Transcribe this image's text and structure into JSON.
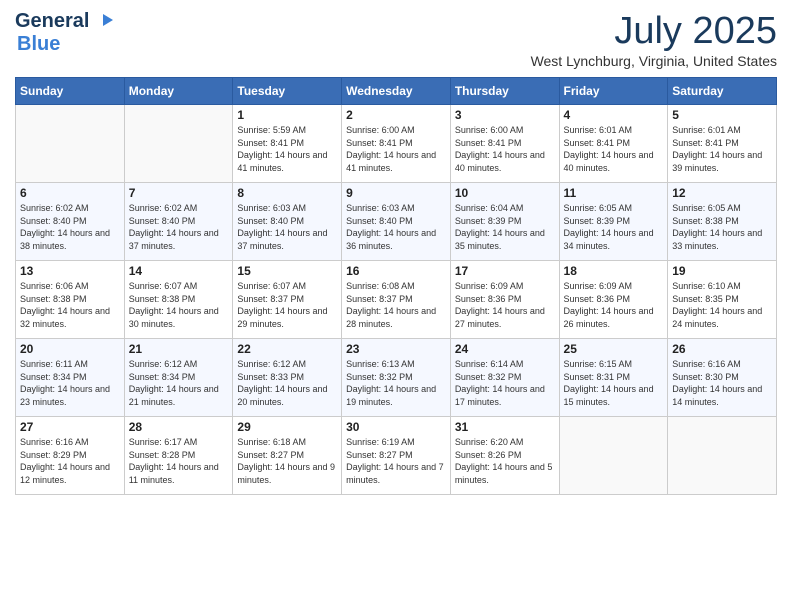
{
  "logo": {
    "part1": "General",
    "part2": "Blue"
  },
  "header": {
    "month": "July 2025",
    "location": "West Lynchburg, Virginia, United States"
  },
  "weekdays": [
    "Sunday",
    "Monday",
    "Tuesday",
    "Wednesday",
    "Thursday",
    "Friday",
    "Saturday"
  ],
  "weeks": [
    [
      {
        "day": "",
        "sunrise": "",
        "sunset": "",
        "daylight": ""
      },
      {
        "day": "",
        "sunrise": "",
        "sunset": "",
        "daylight": ""
      },
      {
        "day": "1",
        "sunrise": "Sunrise: 5:59 AM",
        "sunset": "Sunset: 8:41 PM",
        "daylight": "Daylight: 14 hours and 41 minutes."
      },
      {
        "day": "2",
        "sunrise": "Sunrise: 6:00 AM",
        "sunset": "Sunset: 8:41 PM",
        "daylight": "Daylight: 14 hours and 41 minutes."
      },
      {
        "day": "3",
        "sunrise": "Sunrise: 6:00 AM",
        "sunset": "Sunset: 8:41 PM",
        "daylight": "Daylight: 14 hours and 40 minutes."
      },
      {
        "day": "4",
        "sunrise": "Sunrise: 6:01 AM",
        "sunset": "Sunset: 8:41 PM",
        "daylight": "Daylight: 14 hours and 40 minutes."
      },
      {
        "day": "5",
        "sunrise": "Sunrise: 6:01 AM",
        "sunset": "Sunset: 8:41 PM",
        "daylight": "Daylight: 14 hours and 39 minutes."
      }
    ],
    [
      {
        "day": "6",
        "sunrise": "Sunrise: 6:02 AM",
        "sunset": "Sunset: 8:40 PM",
        "daylight": "Daylight: 14 hours and 38 minutes."
      },
      {
        "day": "7",
        "sunrise": "Sunrise: 6:02 AM",
        "sunset": "Sunset: 8:40 PM",
        "daylight": "Daylight: 14 hours and 37 minutes."
      },
      {
        "day": "8",
        "sunrise": "Sunrise: 6:03 AM",
        "sunset": "Sunset: 8:40 PM",
        "daylight": "Daylight: 14 hours and 37 minutes."
      },
      {
        "day": "9",
        "sunrise": "Sunrise: 6:03 AM",
        "sunset": "Sunset: 8:40 PM",
        "daylight": "Daylight: 14 hours and 36 minutes."
      },
      {
        "day": "10",
        "sunrise": "Sunrise: 6:04 AM",
        "sunset": "Sunset: 8:39 PM",
        "daylight": "Daylight: 14 hours and 35 minutes."
      },
      {
        "day": "11",
        "sunrise": "Sunrise: 6:05 AM",
        "sunset": "Sunset: 8:39 PM",
        "daylight": "Daylight: 14 hours and 34 minutes."
      },
      {
        "day": "12",
        "sunrise": "Sunrise: 6:05 AM",
        "sunset": "Sunset: 8:38 PM",
        "daylight": "Daylight: 14 hours and 33 minutes."
      }
    ],
    [
      {
        "day": "13",
        "sunrise": "Sunrise: 6:06 AM",
        "sunset": "Sunset: 8:38 PM",
        "daylight": "Daylight: 14 hours and 32 minutes."
      },
      {
        "day": "14",
        "sunrise": "Sunrise: 6:07 AM",
        "sunset": "Sunset: 8:38 PM",
        "daylight": "Daylight: 14 hours and 30 minutes."
      },
      {
        "day": "15",
        "sunrise": "Sunrise: 6:07 AM",
        "sunset": "Sunset: 8:37 PM",
        "daylight": "Daylight: 14 hours and 29 minutes."
      },
      {
        "day": "16",
        "sunrise": "Sunrise: 6:08 AM",
        "sunset": "Sunset: 8:37 PM",
        "daylight": "Daylight: 14 hours and 28 minutes."
      },
      {
        "day": "17",
        "sunrise": "Sunrise: 6:09 AM",
        "sunset": "Sunset: 8:36 PM",
        "daylight": "Daylight: 14 hours and 27 minutes."
      },
      {
        "day": "18",
        "sunrise": "Sunrise: 6:09 AM",
        "sunset": "Sunset: 8:36 PM",
        "daylight": "Daylight: 14 hours and 26 minutes."
      },
      {
        "day": "19",
        "sunrise": "Sunrise: 6:10 AM",
        "sunset": "Sunset: 8:35 PM",
        "daylight": "Daylight: 14 hours and 24 minutes."
      }
    ],
    [
      {
        "day": "20",
        "sunrise": "Sunrise: 6:11 AM",
        "sunset": "Sunset: 8:34 PM",
        "daylight": "Daylight: 14 hours and 23 minutes."
      },
      {
        "day": "21",
        "sunrise": "Sunrise: 6:12 AM",
        "sunset": "Sunset: 8:34 PM",
        "daylight": "Daylight: 14 hours and 21 minutes."
      },
      {
        "day": "22",
        "sunrise": "Sunrise: 6:12 AM",
        "sunset": "Sunset: 8:33 PM",
        "daylight": "Daylight: 14 hours and 20 minutes."
      },
      {
        "day": "23",
        "sunrise": "Sunrise: 6:13 AM",
        "sunset": "Sunset: 8:32 PM",
        "daylight": "Daylight: 14 hours and 19 minutes."
      },
      {
        "day": "24",
        "sunrise": "Sunrise: 6:14 AM",
        "sunset": "Sunset: 8:32 PM",
        "daylight": "Daylight: 14 hours and 17 minutes."
      },
      {
        "day": "25",
        "sunrise": "Sunrise: 6:15 AM",
        "sunset": "Sunset: 8:31 PM",
        "daylight": "Daylight: 14 hours and 15 minutes."
      },
      {
        "day": "26",
        "sunrise": "Sunrise: 6:16 AM",
        "sunset": "Sunset: 8:30 PM",
        "daylight": "Daylight: 14 hours and 14 minutes."
      }
    ],
    [
      {
        "day": "27",
        "sunrise": "Sunrise: 6:16 AM",
        "sunset": "Sunset: 8:29 PM",
        "daylight": "Daylight: 14 hours and 12 minutes."
      },
      {
        "day": "28",
        "sunrise": "Sunrise: 6:17 AM",
        "sunset": "Sunset: 8:28 PM",
        "daylight": "Daylight: 14 hours and 11 minutes."
      },
      {
        "day": "29",
        "sunrise": "Sunrise: 6:18 AM",
        "sunset": "Sunset: 8:27 PM",
        "daylight": "Daylight: 14 hours and 9 minutes."
      },
      {
        "day": "30",
        "sunrise": "Sunrise: 6:19 AM",
        "sunset": "Sunset: 8:27 PM",
        "daylight": "Daylight: 14 hours and 7 minutes."
      },
      {
        "day": "31",
        "sunrise": "Sunrise: 6:20 AM",
        "sunset": "Sunset: 8:26 PM",
        "daylight": "Daylight: 14 hours and 5 minutes."
      },
      {
        "day": "",
        "sunrise": "",
        "sunset": "",
        "daylight": ""
      },
      {
        "day": "",
        "sunrise": "",
        "sunset": "",
        "daylight": ""
      }
    ]
  ]
}
